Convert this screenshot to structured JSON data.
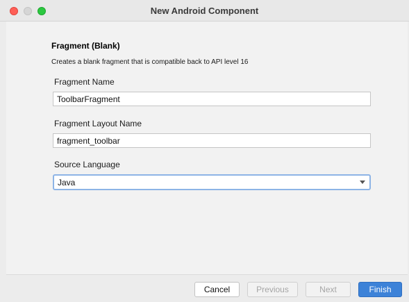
{
  "window": {
    "title": "New Android Component"
  },
  "main": {
    "heading": "Fragment (Blank)",
    "description": "Creates a blank fragment that is compatible back to API level 16",
    "fragment_name": {
      "label": "Fragment Name",
      "value": "ToolbarFragment"
    },
    "layout_name": {
      "label": "Fragment Layout Name",
      "value": "fragment_toolbar"
    },
    "source_language": {
      "label": "Source Language",
      "value": "Java"
    }
  },
  "footer": {
    "cancel_label": "Cancel",
    "previous_label": "Previous",
    "next_label": "Next",
    "finish_label": "Finish"
  },
  "colors": {
    "accent": "#3c82d8",
    "close": "#fe5f57",
    "zoom": "#2bc840",
    "focus_ring": "#8db4e6"
  }
}
